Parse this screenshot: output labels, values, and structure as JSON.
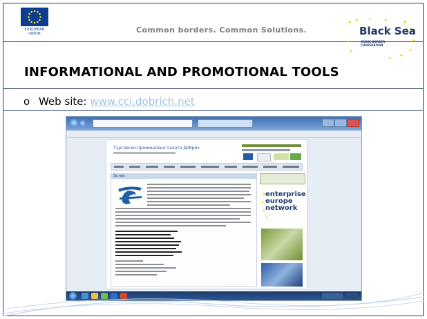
{
  "header": {
    "eu_caption": "EUROPEAN UNION",
    "tagline": "Common borders. Common Solutions.",
    "blacksea_logo_text": "Black Sea",
    "blacksea_logo_sub": "CROSS BORDER COOPERATION"
  },
  "slide": {
    "title": "INFORMATIONAL AND PROMOTIONAL TOOLS",
    "bullet_marker": "o",
    "bullet_label": "Web site:",
    "bullet_link": "www.cci.dobrich.net"
  },
  "screenshot": {
    "site_title": "Търговско-промишлена палата Добрич",
    "een_line1": "enterprise",
    "een_line2": "europe",
    "een_line3": "network",
    "content_heading": "За нас"
  },
  "colors": {
    "navy": "#1f3864",
    "link": "#9dc3e6",
    "eu_blue": "#0b3d91",
    "star_yellow": "#ffd200"
  }
}
